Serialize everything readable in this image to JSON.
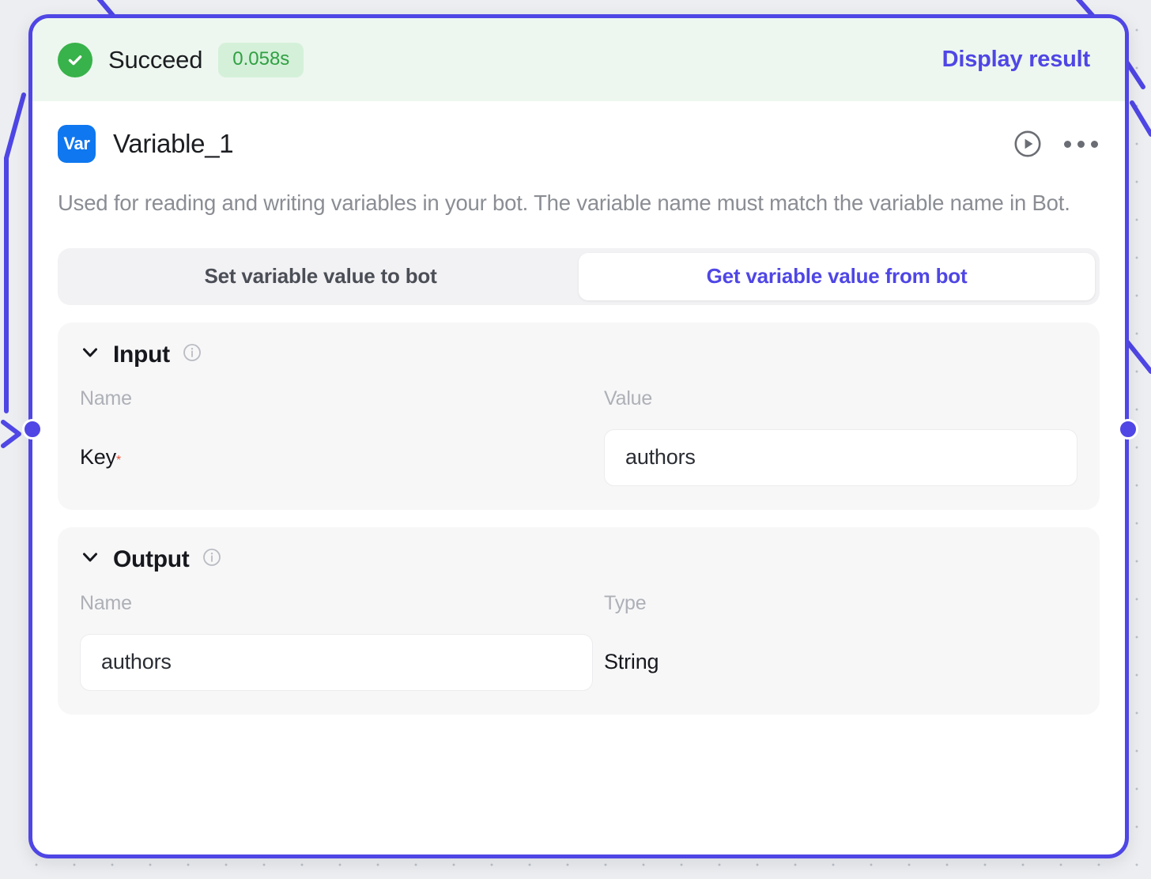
{
  "status": {
    "icon": "check-circle-icon",
    "label": "Succeed",
    "duration": "0.058s",
    "display_result_label": "Display result",
    "accent_success": "#38b24a",
    "accent_link": "#4f46e5"
  },
  "node": {
    "badge": "Var",
    "title": "Variable_1",
    "description": "Used for reading and writing variables in your bot. The variable name must match the variable name in Bot.",
    "run_icon": "play-circle-icon",
    "more_icon": "more-horizontal-icon"
  },
  "mode_tabs": [
    {
      "label": "Set variable value to bot",
      "active": false
    },
    {
      "label": "Get variable value from bot",
      "active": true
    }
  ],
  "input_section": {
    "title": "Input",
    "collapsed": false,
    "chevron_icon": "chevron-down-icon",
    "info_icon": "info-circle-icon",
    "columns": [
      "Name",
      "Value"
    ],
    "rows": [
      {
        "name": "Key",
        "required": true,
        "value": "authors"
      }
    ]
  },
  "output_section": {
    "title": "Output",
    "collapsed": false,
    "chevron_icon": "chevron-down-icon",
    "info_icon": "info-circle-icon",
    "columns": [
      "Name",
      "Type"
    ],
    "rows": [
      {
        "name": "authors",
        "type": "String"
      }
    ]
  },
  "handles": {
    "input_handle": "input-connection-handle",
    "output_handle": "output-connection-handle"
  }
}
